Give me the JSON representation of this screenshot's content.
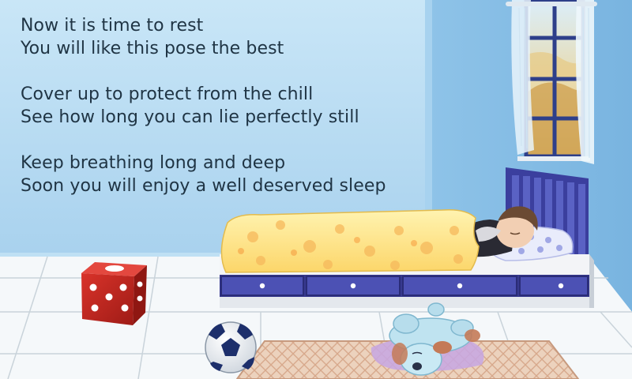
{
  "verse": [
    [
      "Now it is time to rest",
      "You will like this pose the best"
    ],
    [
      "Cover up to protect from the chill",
      "See how long you can lie perfectly still"
    ],
    [
      "Keep breathing long and deep",
      "Soon you will enjoy a well deserved sleep"
    ]
  ],
  "colors": {
    "wall": "#bfe0f4",
    "floor": "#f4f7f9",
    "text": "#1f3444",
    "bed_frame": "#3e3e9a",
    "blanket": "#fde68a",
    "dice": "#c0261e",
    "rug": "#e8c9b0"
  },
  "objects": [
    "bedroom-window",
    "bed",
    "sleeping-child",
    "pillow",
    "dice-toy",
    "soccer-ball",
    "stuffed-puppy",
    "rug"
  ]
}
